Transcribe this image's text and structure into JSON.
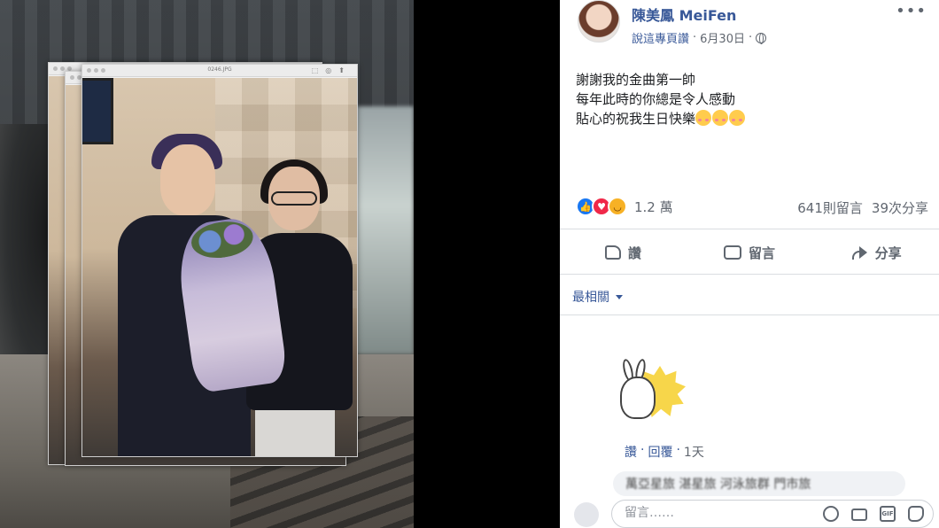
{
  "post": {
    "page_name": "陳美鳳 MeiFen",
    "meta_prefix": "說這專頁讚",
    "dot1": "·",
    "date": "6月30日",
    "dot2": "·",
    "text_lines": [
      "謝謝我的金曲第一帥",
      "每年此時的你總是令人感動",
      "貼心的祝我生日快樂"
    ]
  },
  "photo": {
    "filename": "0246.JPG"
  },
  "stats": {
    "reactions_count": "1.2 萬",
    "comments_count": "641則留言",
    "shares_count": "39次分享"
  },
  "actions": {
    "like": "讚",
    "comment": "留言",
    "share": "分享"
  },
  "comments": {
    "sort_label": "最相關",
    "reply_like": "讚",
    "sep1": "·",
    "reply": "回覆",
    "sep2": "·",
    "time": "1天",
    "blurred_text": "萬亞星旅 湛星旅 河泳旅群 門市旅",
    "composer_placeholder": "留言……"
  },
  "colors": {
    "link": "#385898",
    "like_blue": "#1877f2",
    "love_red": "#f02849",
    "haha_yellow": "#f7b125"
  }
}
